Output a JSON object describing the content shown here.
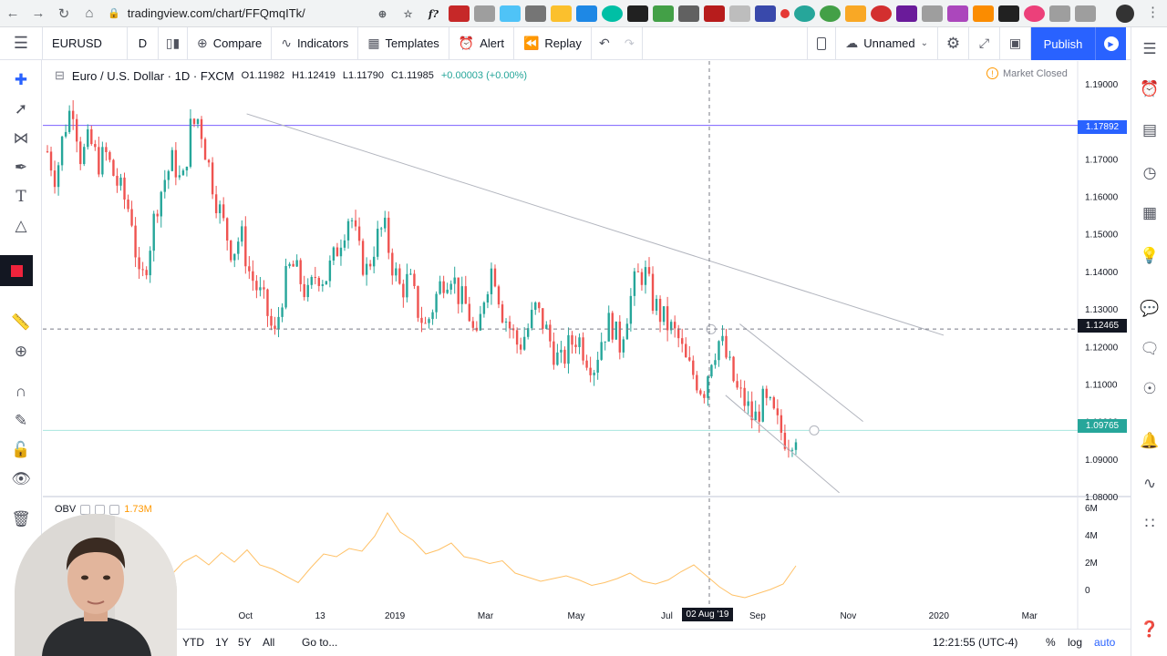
{
  "browser": {
    "url": "tradingview.com/chart/FFQmqITk/",
    "fx_ext_label": "f?"
  },
  "toolbar": {
    "symbol": "EURUSD",
    "interval": "D",
    "compare": "Compare",
    "indicators": "Indicators",
    "templates": "Templates",
    "alert": "Alert",
    "replay": "Replay",
    "layout_name": "Unnamed",
    "publish": "Publish"
  },
  "legend": {
    "title": "Euro / U.S. Dollar",
    "interval": "1D",
    "exchange": "FXCM",
    "open": "O1.11982",
    "high": "H1.12419",
    "low": "L1.11790",
    "close": "C1.11985",
    "change": "+0.00003 (+0.00%)",
    "market_status": "Market Closed"
  },
  "price_axis": {
    "ticks": [
      "1.19000",
      "1.17000",
      "1.16000",
      "1.15000",
      "1.14000",
      "1.13000",
      "1.12000",
      "1.11000",
      "1.10000",
      "1.09000",
      "1.08000"
    ],
    "tag_blue": "1.17892",
    "tag_crosshair": "1.12465",
    "tag_current": "1.09765"
  },
  "obv": {
    "label": "OBV",
    "value": "1.73M",
    "ticks": [
      "6M",
      "4M",
      "2M",
      "0"
    ]
  },
  "time_axis": {
    "labels": [
      "Oct",
      "13",
      "2019",
      "Mar",
      "May",
      "Jul",
      "Sep",
      "Nov",
      "2020",
      "Mar"
    ],
    "crosshair_date": "02 Aug '19"
  },
  "bottom": {
    "ranges": [
      "YTD",
      "1Y",
      "5Y",
      "All"
    ],
    "partial_range": "M",
    "goto": "Go to...",
    "clock": "12:21:55 (UTC-4)",
    "percent": "%",
    "log": "log",
    "auto": "auto"
  },
  "colors": {
    "up": "#26a69a",
    "down": "#ef5350",
    "accent": "#2962ff",
    "obv": "#ff9800",
    "current_price": "#26a69a"
  },
  "chart_data": {
    "type": "candlestick",
    "symbol": "EURUSD",
    "interval": "1D",
    "ylim": [
      1.08,
      1.19
    ],
    "x_labels": [
      "Oct",
      "13",
      "2019",
      "Mar",
      "May",
      "Jul",
      "Sep",
      "Nov",
      "2020",
      "Mar"
    ],
    "price_path": [
      1.172,
      1.165,
      1.178,
      1.185,
      1.17,
      1.175,
      1.169,
      1.171,
      1.165,
      1.16,
      1.155,
      1.135,
      1.145,
      1.158,
      1.165,
      1.17,
      1.162,
      1.178,
      1.181,
      1.17,
      1.16,
      1.152,
      1.145,
      1.15,
      1.14,
      1.135,
      1.13,
      1.122,
      1.135,
      1.142,
      1.138,
      1.133,
      1.14,
      1.138,
      1.143,
      1.15,
      1.156,
      1.145,
      1.14,
      1.148,
      1.152,
      1.142,
      1.135,
      1.138,
      1.13,
      1.125,
      1.132,
      1.138,
      1.14,
      1.133,
      1.13,
      1.12,
      1.135,
      1.142,
      1.13,
      1.125,
      1.12,
      1.124,
      1.13,
      1.126,
      1.12,
      1.115,
      1.12,
      1.123,
      1.118,
      1.115,
      1.123,
      1.127,
      1.12,
      1.13,
      1.138,
      1.14,
      1.132,
      1.128,
      1.125,
      1.122,
      1.115,
      1.112,
      1.108,
      1.118,
      1.122,
      1.115,
      1.108,
      1.105,
      1.1,
      1.105,
      1.103,
      1.098,
      1.095,
      1.0975
    ],
    "obv_path": [
      1.0,
      2.0,
      2.5,
      1.8,
      2.7,
      2.0,
      2.9,
      1.8,
      1.5,
      1.0,
      0.5,
      1.6,
      2.6,
      2.4,
      3.0,
      2.8,
      3.9,
      5.6,
      4.2,
      3.6,
      2.6,
      2.9,
      3.4,
      2.4,
      2.2,
      1.9,
      2.1,
      1.2,
      0.9,
      0.6,
      0.8,
      1.0,
      0.7,
      0.3,
      0.5,
      0.8,
      1.2,
      0.6,
      0.4,
      0.7,
      1.3,
      1.8,
      1.0,
      0.2,
      -0.4,
      -0.6,
      -0.3,
      0.0,
      0.4,
      1.73
    ],
    "obv_ylim": [
      -1,
      6
    ],
    "horizontal_levels": [
      1.17892,
      1.09765
    ],
    "crosshair_price": 1.12465,
    "trendlines": [
      {
        "from": [
          0.215,
          1.182
        ],
        "to": [
          0.95,
          1.123
        ]
      },
      {
        "from": [
          0.735,
          1.126
        ],
        "to": [
          0.865,
          1.1
        ]
      },
      {
        "from": [
          0.72,
          1.107
        ],
        "to": [
          0.84,
          1.081
        ]
      }
    ]
  }
}
